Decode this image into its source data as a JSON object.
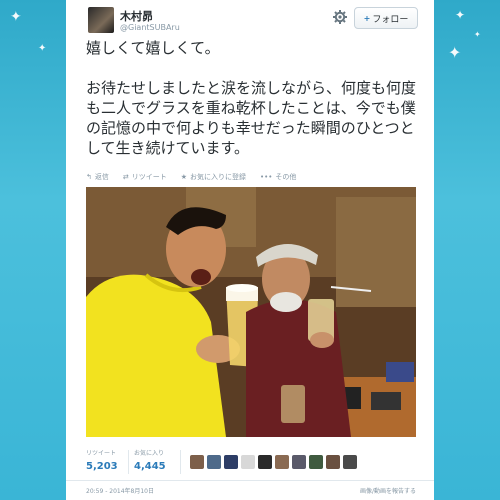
{
  "profile": {
    "display_name": "木村昴",
    "handle": "@GiantSUBAru"
  },
  "header": {
    "follow_label": "フォロー",
    "follow_plus": "+",
    "settings_icon": "gear-icon"
  },
  "tweet": {
    "line1": "嬉しくて嬉しくて。",
    "line2": "お待たせしましたと涙を流しながら、何度も何度も二人でグラスを重ね乾杯したことは、今でも僕の記憶の中で何よりも幸せだった瞬間のひとつとして生き続けています。"
  },
  "actions": {
    "reply": "返信",
    "retweet": "リツイート",
    "favorite": "お気に入りに登録",
    "more": "その他"
  },
  "stats": {
    "retweets_label": "リツイート",
    "retweets_value": "5,203",
    "favorites_label": "お気に入り",
    "favorites_value": "4,445"
  },
  "footer": {
    "timestamp": "20:59 - 2014年8月10日",
    "report": "画像/動画を報告する"
  },
  "colors": {
    "accent": "#2b7bb9",
    "background": "#3ab5d6"
  }
}
